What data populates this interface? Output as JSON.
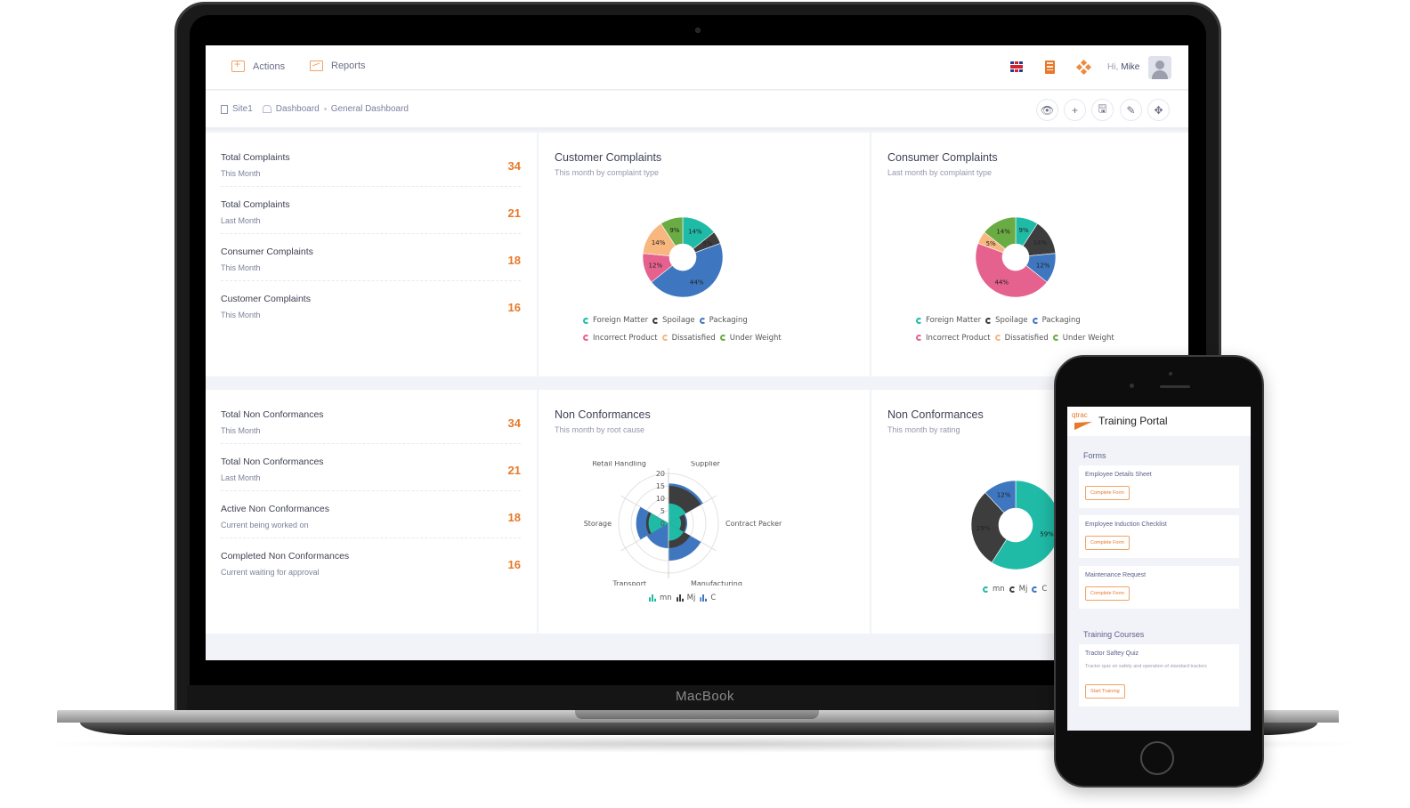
{
  "device": {
    "laptop_label": "MacBook"
  },
  "topbar": {
    "nav": [
      {
        "label": "Actions",
        "icon": "add-box-icon"
      },
      {
        "label": "Reports",
        "icon": "presentation-chart-icon"
      }
    ],
    "greeting_prefix": "Hi,",
    "user_name": "Mike",
    "icons": [
      "uk-flag-icon",
      "building-icon",
      "apps-diamond-icon",
      "user-avatar-icon"
    ]
  },
  "breadcrumb": {
    "site": "Site1",
    "items": [
      "Dashboard",
      "General Dashboard"
    ]
  },
  "toolbar": {
    "buttons": [
      {
        "name": "view",
        "icon": "eye-icon",
        "glyph": "👁"
      },
      {
        "name": "add",
        "icon": "plus-icon",
        "glyph": "+"
      },
      {
        "name": "save",
        "icon": "save-icon",
        "glyph": "🖫"
      },
      {
        "name": "edit",
        "icon": "pencil-icon",
        "glyph": "✎"
      },
      {
        "name": "move",
        "icon": "move-icon",
        "glyph": "✥"
      }
    ]
  },
  "complaints_kpis": [
    {
      "title": "Total Complaints",
      "sub": "This Month",
      "value": "34"
    },
    {
      "title": "Total Complaints",
      "sub": "Last Month",
      "value": "21"
    },
    {
      "title": "Consumer Complaints",
      "sub": "This Month",
      "value": "18"
    },
    {
      "title": "Customer Complaints",
      "sub": "This Month",
      "value": "16"
    }
  ],
  "nc_kpis": [
    {
      "title": "Total Non Conformances",
      "sub": "This Month",
      "value": "34"
    },
    {
      "title": "Total Non Conformances",
      "sub": "Last Month",
      "value": "21"
    },
    {
      "title": "Active Non Conformances",
      "sub": "Current being worked on",
      "value": "18"
    },
    {
      "title": "Completed Non Conformances",
      "sub": "Current waiting for approval",
      "value": "16"
    }
  ],
  "colors": {
    "accent": "#e8782a",
    "foreign_matter": "#1fbba6",
    "spoilage": "#3d3d3d",
    "packaging": "#3e77c0",
    "incorrect_product": "#e5628e",
    "dissatisfied": "#f7b77e",
    "under_weight": "#6aab44"
  },
  "chart_data": [
    {
      "type": "pie",
      "title": "Customer Complaints",
      "subtitle": "This month by complaint type",
      "categories": [
        "Foreign Matter",
        "Spoilage",
        "Packaging",
        "Incorrect Product",
        "Dissatisfied",
        "Under Weight"
      ],
      "values": [
        14,
        5,
        44,
        12,
        14,
        9
      ],
      "colors": [
        "#1fbba6",
        "#3d3d3d",
        "#3e77c0",
        "#e5628e",
        "#f7b77e",
        "#6aab44"
      ],
      "unit": "%",
      "legend": "bottom"
    },
    {
      "type": "pie",
      "title": "Consumer Complaints",
      "subtitle": "Last month by complaint type",
      "categories": [
        "Foreign Matter",
        "Spoilage",
        "Packaging",
        "Incorrect Product",
        "Dissatisfied",
        "Under Weight"
      ],
      "values": [
        9,
        14,
        12,
        44,
        5,
        14
      ],
      "colors": [
        "#1fbba6",
        "#3d3d3d",
        "#3e77c0",
        "#e5628e",
        "#f7b77e",
        "#6aab44"
      ],
      "unit": "%",
      "legend": "bottom"
    },
    {
      "type": "bar",
      "subtype": "polar-stacked",
      "title": "Non Conformances",
      "subtitle": "This month by root cause",
      "categories": [
        "Supplier",
        "Contract Packer",
        "Manufacturing",
        "Transport",
        "Storage",
        "Retail Handling"
      ],
      "series": [
        {
          "name": "mn",
          "values": [
            8,
            5,
            7,
            0,
            8,
            0
          ],
          "color": "#1fbba6"
        },
        {
          "name": "Mj",
          "values": [
            7,
            2,
            3,
            0,
            1,
            0
          ],
          "color": "#3d3d3d"
        },
        {
          "name": "C",
          "values": [
            1,
            0.5,
            5,
            10,
            4,
            0
          ],
          "color": "#3e77c0"
        }
      ],
      "radial_ticks": [
        0,
        5,
        10,
        15,
        20
      ],
      "rlim": [
        0,
        20
      ],
      "grid": true,
      "legend": "bottom"
    },
    {
      "type": "pie",
      "title": "Non Conformances",
      "subtitle": "This month by rating",
      "categories": [
        "mn",
        "Mj",
        "C"
      ],
      "values": [
        59,
        29,
        12
      ],
      "colors": [
        "#1fbba6",
        "#3d3d3d",
        "#3e77c0"
      ],
      "unit": "%",
      "legend": "bottom"
    }
  ],
  "phone": {
    "logo": "qtrac",
    "title": "Training Portal",
    "forms_heading": "Forms",
    "forms": [
      {
        "title": "Employee Details Sheet",
        "button": "Complete Form"
      },
      {
        "title": "Employee Induction Checklist",
        "button": "Complete Form"
      },
      {
        "title": "Maintenance Request",
        "button": "Complete Form"
      }
    ],
    "courses_heading": "Training Courses",
    "courses": [
      {
        "title": "Tractor Saftey Quiz",
        "description": "Tractor quiz on safety and operation of standard tractors",
        "button": "Start Training"
      }
    ]
  }
}
